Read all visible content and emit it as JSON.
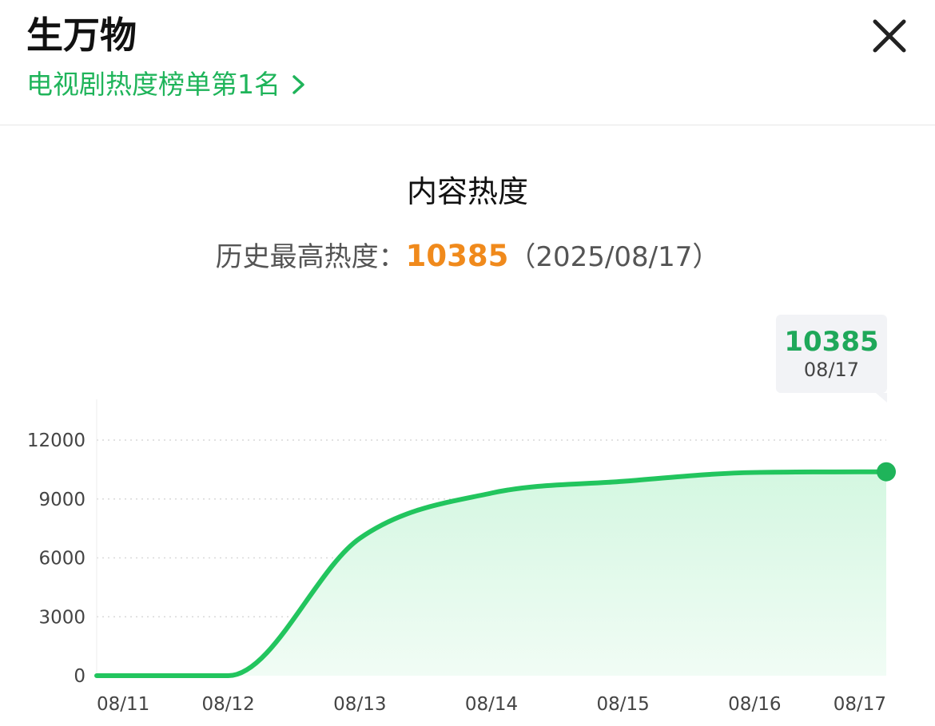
{
  "header": {
    "show_title": "生万物",
    "rank_text": "电视剧热度榜单第1名"
  },
  "icons": {
    "close": "close-icon",
    "chevron": "chevron-right-icon"
  },
  "colors": {
    "accent_green": "#1fb45a",
    "peak_orange": "#f08a1c",
    "line_green": "#22c55e",
    "fill_green": "#dcf8e6"
  },
  "section": {
    "title": "内容热度",
    "peak_label": "历史最高热度：",
    "peak_value": "10385",
    "peak_date": "（2025/08/17）"
  },
  "tooltip": {
    "value": "10385",
    "date": "08/17"
  },
  "chart_data": {
    "type": "area",
    "title": "",
    "xlabel": "",
    "ylabel": "",
    "categories": [
      "08/11",
      "08/12",
      "08/13",
      "08/14",
      "08/15",
      "08/16",
      "08/17"
    ],
    "series": [
      {
        "values": [
          0,
          0,
          7000,
          9300,
          9900,
          10350,
          10385
        ]
      }
    ],
    "y_ticks": [
      "0",
      "3000",
      "6000",
      "9000",
      "12000"
    ],
    "ylim": [
      0,
      12000
    ],
    "grid": true,
    "highlight_point": {
      "x": "08/17",
      "y": 10385
    }
  }
}
